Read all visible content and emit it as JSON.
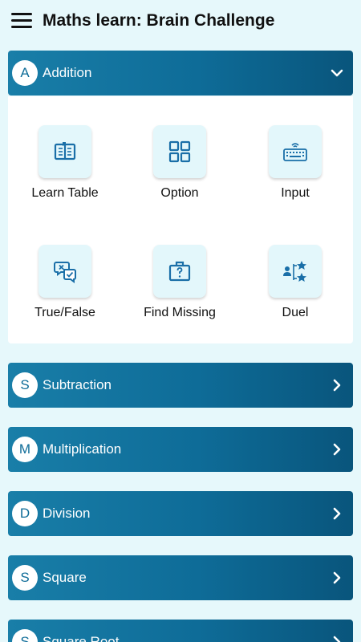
{
  "header": {
    "title": "Maths learn: Brain Challenge"
  },
  "expanded_section": {
    "badge": "A",
    "label": "Addition",
    "options": [
      {
        "label": "Learn Table",
        "icon": "book-icon"
      },
      {
        "label": "Option",
        "icon": "grid-icon"
      },
      {
        "label": "Input",
        "icon": "keyboard-icon"
      },
      {
        "label": "True/False",
        "icon": "chat-check-icon"
      },
      {
        "label": "Find Missing",
        "icon": "question-box-icon"
      },
      {
        "label": "Duel",
        "icon": "duel-stars-icon"
      }
    ]
  },
  "sections": [
    {
      "badge": "S",
      "label": "Subtraction"
    },
    {
      "badge": "M",
      "label": "Multiplication"
    },
    {
      "badge": "D",
      "label": "Division"
    },
    {
      "badge": "S",
      "label": "Square"
    },
    {
      "badge": "S",
      "label": "Square Root"
    }
  ],
  "colors": {
    "background": "#e6f8fb",
    "header_gradient_start": "#197ea8",
    "header_gradient_end": "#09557c",
    "icon_color": "#1a6fa8"
  }
}
